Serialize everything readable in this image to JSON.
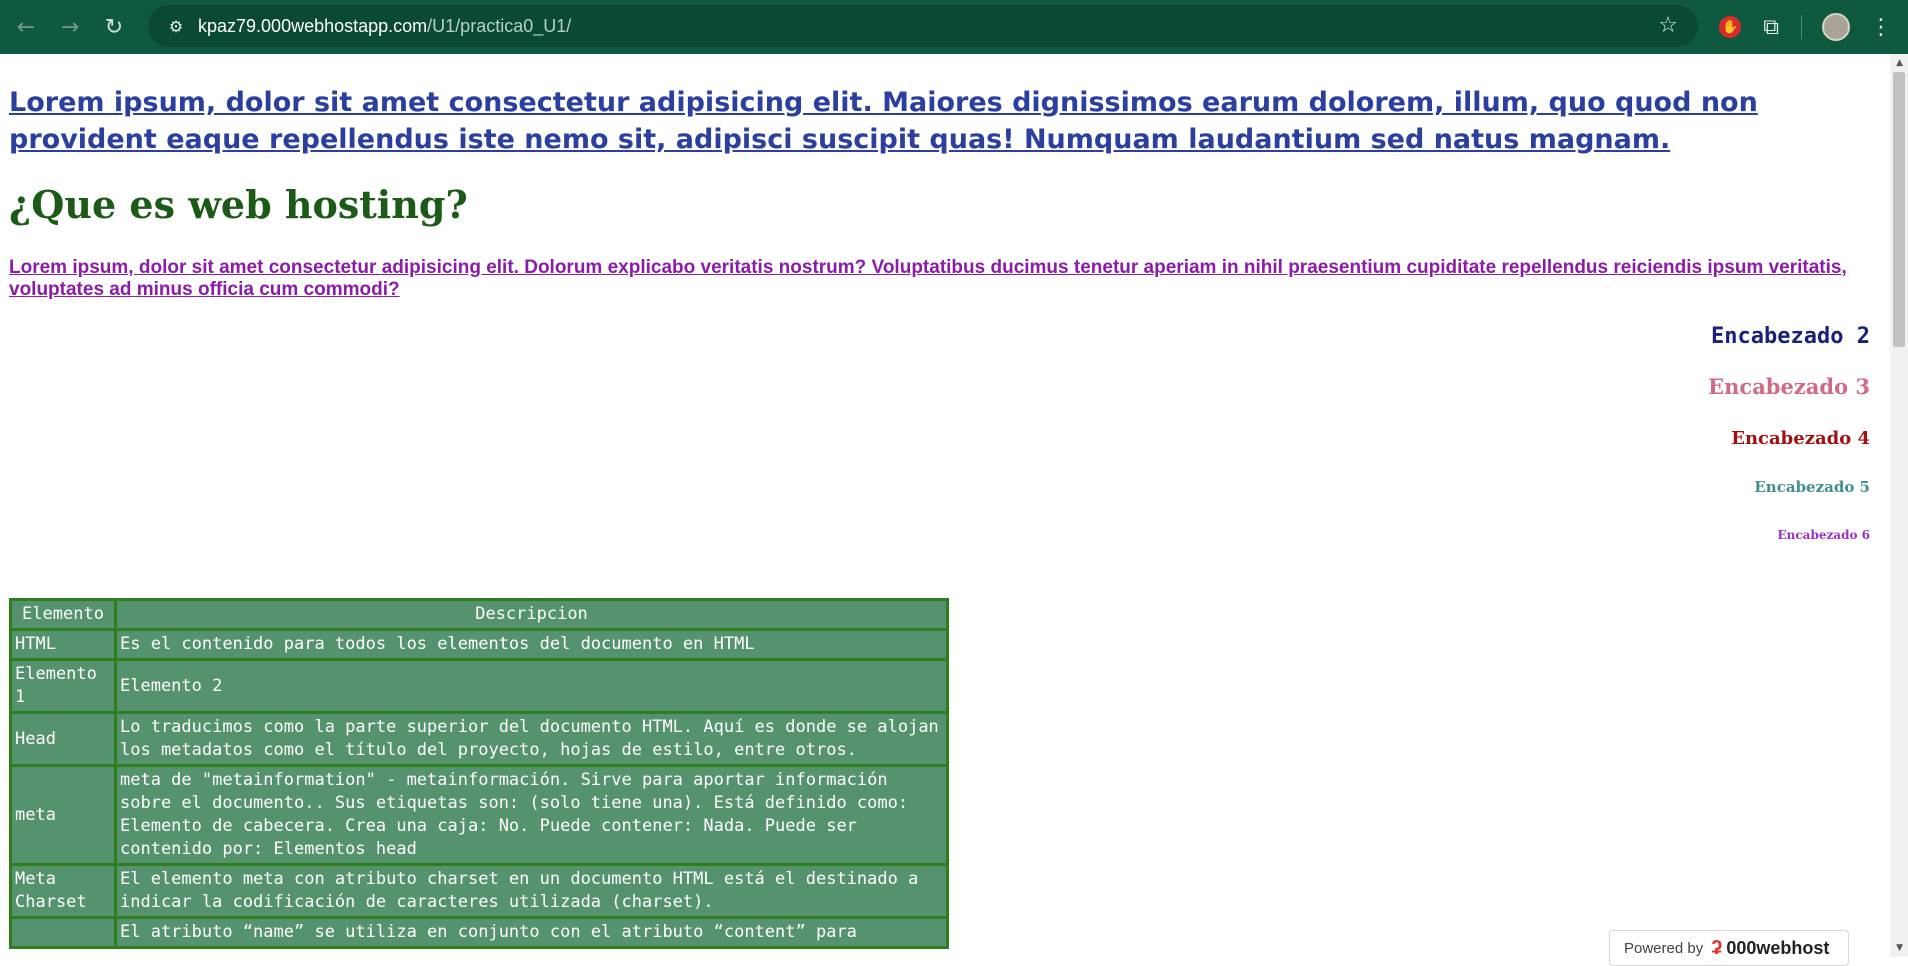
{
  "browser": {
    "url_host": "kpaz79.000webhostapp.com",
    "url_path": "/U1/practica0_U1/",
    "icons": {
      "back": "arrow-left",
      "forward": "arrow-right",
      "reload": "reload",
      "site_info": "tune",
      "bookmark": "star",
      "extension_red": "hand-stop",
      "extensions": "puzzle",
      "profile": "avatar",
      "menu": "kebab"
    }
  },
  "page": {
    "main_link": "Lorem ipsum, dolor sit amet consectetur adipisicing elit. Maiores dignissimos earum dolorem, illum, quo quod non provident eaque repellendus iste nemo sit, adipisci suscipit quas! Numquam laudantium sed natus magnam.",
    "title": "¿Que es web hosting?",
    "paragraph_link": "Lorem ipsum, dolor sit amet consectetur adipisicing elit. Dolorum explicabo veritatis nostrum? Voluptatibus ducimus tenetur aperiam in nihil praesentium cupiditate repellendus reiciendis ipsum veritatis, voluptates ad minus officia cum commodi?",
    "headings": {
      "h2": "Encabezado 2",
      "h3": "Encabezado 3",
      "h4": "Encabezado 4",
      "h5": "Encabezado 5",
      "h6": "Encabezado 6"
    },
    "table": {
      "headers": [
        "Elemento",
        "Descripcion"
      ],
      "rows": [
        [
          "HTML",
          "Es el contenido para todos los elementos del documento en HTML"
        ],
        [
          "Elemento 1",
          "Elemento 2"
        ],
        [
          "Head",
          "Lo traducimos como la parte superior del documento HTML. Aquí es donde se alojan los metadatos como el título del proyecto, hojas de estilo, entre otros."
        ],
        [
          "meta",
          "meta de \"metainformation\" - metainformación. Sirve para aportar información sobre el documento.. Sus etiquetas son: (solo tiene una). Está definido como: Elemento de cabecera. Crea una caja: No. Puede contener: Nada. Puede ser contenido por: Elementos head"
        ],
        [
          "Meta Charset",
          "El elemento meta con atributo charset en un documento HTML está el destinado a indicar la codificación de caracteres utilizada (charset)."
        ],
        [
          "",
          "El atributo “name” se utiliza en conjunto con el atributo “content” para"
        ]
      ]
    },
    "powered_by": {
      "label": "Powered by",
      "brand": "000webhost"
    }
  },
  "colors": {
    "chrome_bg": "#0f5a3e",
    "main_link": "#2a3f9f",
    "title": "#1c5a17",
    "paragraph_link": "#8a1ca8",
    "table_bg": "#55936e",
    "table_border": "#2e7d1f"
  }
}
